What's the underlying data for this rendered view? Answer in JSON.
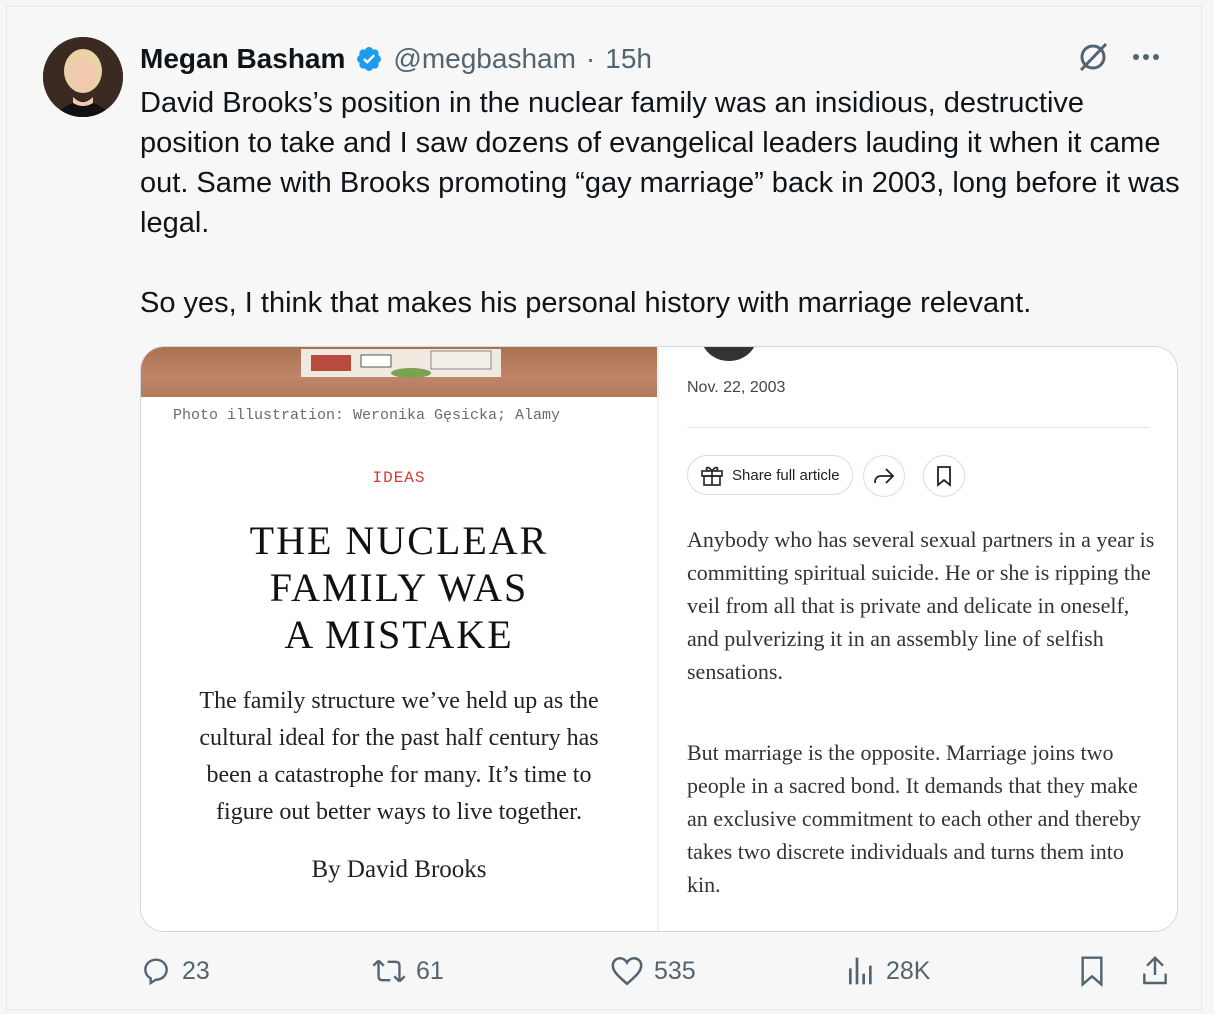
{
  "author": {
    "name": "Megan Basham",
    "handle": "@megbasham",
    "separator": "·",
    "time": "15h"
  },
  "tweet": {
    "text": "David Brooks’s position in the nuclear family was an insidious, destructive position to take and I saw dozens of evangelical leaders lauding it when it came out. Same with Brooks promoting “gay marriage” back in 2003, long before it was legal.\n\nSo yes, I think that makes his personal history with marriage relevant."
  },
  "media": {
    "left": {
      "credit": "Photo illustration: Weronika Gęsicka; Alamy",
      "section": "IDEAS",
      "headline": "THE NUCLEAR\nFAMILY WAS\nA MISTAKE",
      "dek": "The family structure we’ve held up as the cultural ideal for the past half century has been a catastrophe for many. It’s time to figure out better ways to live together.",
      "byline": "By David Brooks"
    },
    "right": {
      "date": "Nov. 22, 2003",
      "share_label": "Share full article",
      "paragraph1": "Anybody who has several sexual partners in a year is committing spiritual suicide. He or she is ripping the veil from all that is private and delicate in oneself, and pulverizing it in an assembly line of selfish sensations.",
      "paragraph2": "But marriage is the opposite. Marriage joins two people in a sacred bond. It demands that they make an exclusive commitment to each other and thereby takes two discrete individuals and turns them into kin."
    }
  },
  "actions": {
    "replies": "23",
    "reposts": "61",
    "likes": "535",
    "views": "28K"
  },
  "icons": {
    "verified": "verified-badge-icon",
    "grok": "grok-icon",
    "more": "more-icon",
    "reply": "reply-icon",
    "repost": "repost-icon",
    "like": "heart-icon",
    "views": "views-icon",
    "bookmark": "bookmark-icon",
    "share": "share-icon"
  },
  "colors": {
    "verified": "#1d9bf0",
    "text": "#0f1419",
    "muted": "#536471",
    "ideas_red": "#d23a2e"
  }
}
